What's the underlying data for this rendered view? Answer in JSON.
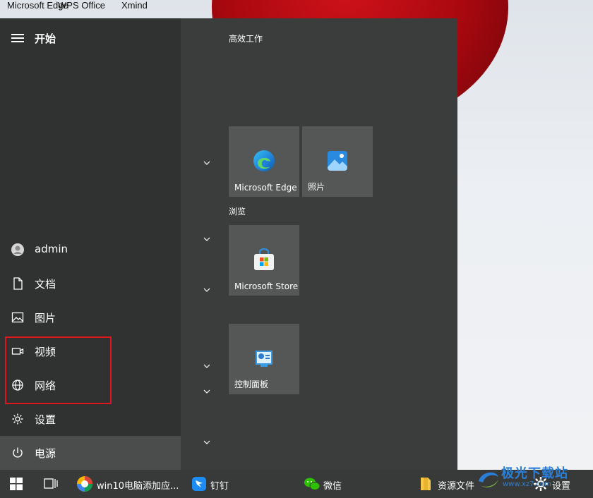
{
  "desktop": {
    "icons": [
      {
        "label": "Microsoft Edge"
      },
      {
        "label": "WPS Office"
      },
      {
        "label": "Xmind"
      }
    ]
  },
  "start": {
    "title": "开始",
    "menu_icon": "hamburger-icon",
    "rail_items": [
      {
        "label": "admin",
        "icon": "user-avatar-icon"
      },
      {
        "label": "文档",
        "icon": "document-icon"
      },
      {
        "label": "图片",
        "icon": "picture-icon"
      },
      {
        "label": "视频",
        "icon": "video-icon"
      },
      {
        "label": "网络",
        "icon": "network-icon"
      },
      {
        "label": "设置",
        "icon": "gear-icon"
      },
      {
        "label": "电源",
        "icon": "power-icon"
      }
    ],
    "groups": [
      {
        "title": "高效工作"
      },
      {
        "title": "浏览"
      }
    ],
    "tiles": [
      {
        "label": "Microsoft Edge",
        "icon": "edge-icon"
      },
      {
        "label": "照片",
        "icon": "photos-icon"
      },
      {
        "label": "Microsoft Store",
        "icon": "store-icon"
      },
      {
        "label": "控制面板",
        "icon": "control-panel-icon"
      }
    ]
  },
  "taskbar": {
    "start_icon": "windows-logo-icon",
    "taskview_icon": "task-view-icon",
    "apps": [
      {
        "label": "win10电脑添加应...",
        "icon": "browser-icon"
      },
      {
        "label": "钉钉",
        "icon": "dingtalk-icon"
      },
      {
        "label": "微信",
        "icon": "wechat-icon"
      },
      {
        "label": "资源文件",
        "icon": "folder-icon"
      },
      {
        "label": "设置",
        "icon": "gear-icon"
      }
    ]
  },
  "watermark": {
    "text": "极光下载站",
    "url": "www.xz7.com"
  },
  "colors": {
    "highlight": "#e0161e",
    "tile_bg": "#555756",
    "rail_bg": "#2f3230",
    "taskbar_bg": "#373a39"
  }
}
